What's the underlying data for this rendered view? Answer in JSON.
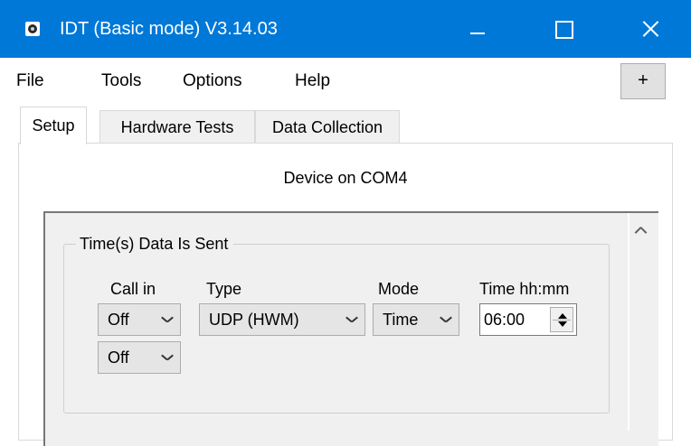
{
  "window": {
    "title": "IDT (Basic mode) V3.14.03",
    "accent_color": "#0078d7",
    "icons": [
      "app-icon",
      "minimize-icon",
      "maximize-icon",
      "close-icon"
    ]
  },
  "menu": {
    "items": [
      "File",
      "Tools",
      "Options",
      "Help"
    ],
    "plus_label": "+"
  },
  "tabs": [
    {
      "label": "Setup",
      "active": true
    },
    {
      "label": "Hardware Tests",
      "active": false
    },
    {
      "label": "Data Collection",
      "active": false
    }
  ],
  "device_status": "Device on COM4",
  "group": {
    "title": "Time(s) Data Is Sent",
    "columns": {
      "call_in": "Call in",
      "type": "Type",
      "mode": "Mode",
      "time": "Time hh:mm"
    },
    "call_in_values": [
      "Off",
      "Off"
    ],
    "type_value": "UDP (HWM)",
    "mode_value": "Time",
    "time_value": "06:00"
  }
}
